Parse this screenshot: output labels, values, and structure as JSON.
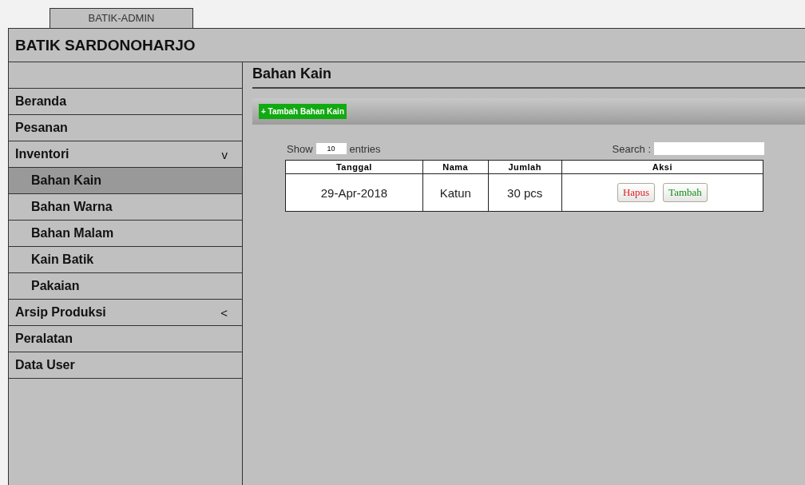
{
  "tab": {
    "label": "BATIK-ADMIN"
  },
  "header": {
    "title": "BATIK SARDONOHARJO"
  },
  "sidebar": {
    "items": [
      {
        "label": "Beranda",
        "selected": false
      },
      {
        "label": "Pesanan",
        "selected": false
      },
      {
        "label": "Inventori",
        "selected": false,
        "indicator": "v",
        "children": [
          {
            "label": "Bahan Kain",
            "selected": true
          },
          {
            "label": "Bahan Warna",
            "selected": false
          },
          {
            "label": "Bahan Malam",
            "selected": false
          },
          {
            "label": "Kain Batik",
            "selected": false
          },
          {
            "label": "Pakaian",
            "selected": false
          }
        ]
      },
      {
        "label": "Arsip Produksi",
        "selected": false,
        "indicator": "<"
      },
      {
        "label": "Peralatan",
        "selected": false
      },
      {
        "label": "Data User",
        "selected": false
      }
    ]
  },
  "content": {
    "title": "Bahan Kain",
    "add_button": "+ Tambah Bahan Kain",
    "show_label": "Show",
    "page_size": "10",
    "entries_label": "entries",
    "search_label": "Search :",
    "table": {
      "columns": [
        "Tanggal",
        "Nama",
        "Jumlah",
        "Aksi"
      ],
      "rows": [
        {
          "cells": [
            "29-Apr-2018",
            "Katun",
            "30 pcs"
          ],
          "actions": [
            {
              "label": "Hapus",
              "kind": "delete"
            },
            {
              "label": "Tambah",
              "kind": "add"
            }
          ]
        }
      ]
    }
  }
}
